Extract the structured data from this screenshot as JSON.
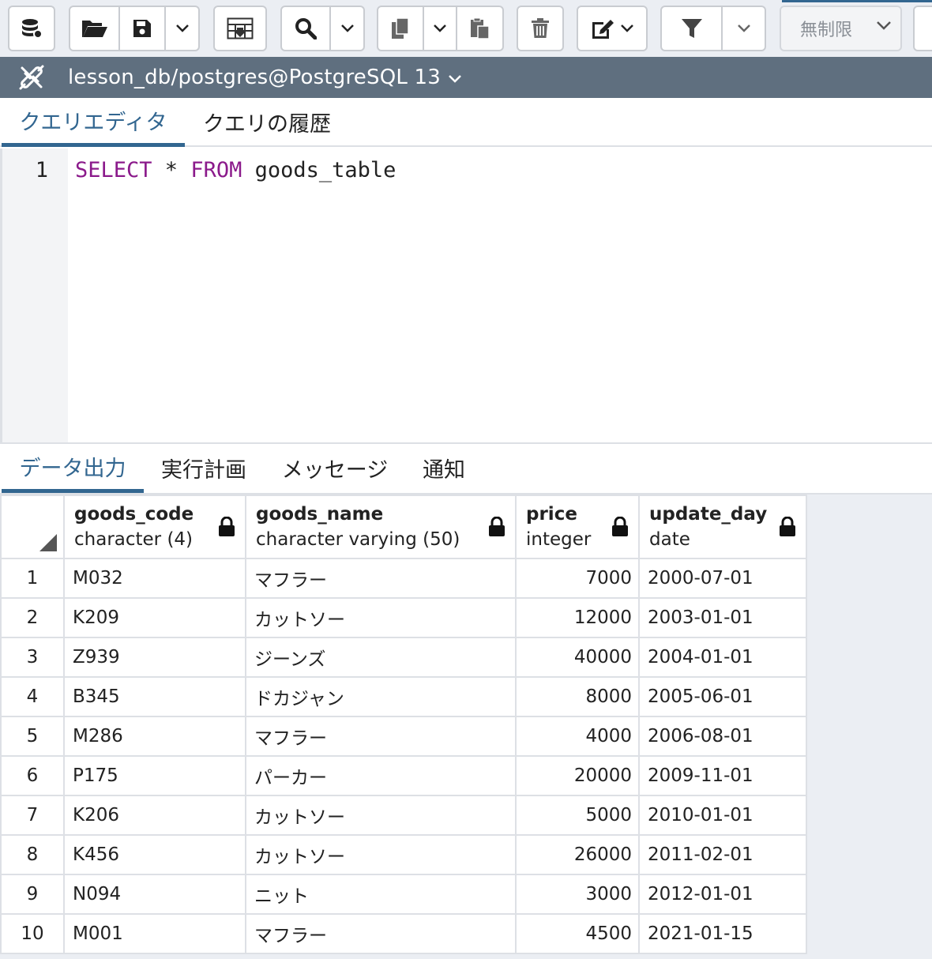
{
  "toolbar": {
    "limit_label": "無制限",
    "icons": [
      "database-icon",
      "folder-open-icon",
      "save-icon",
      "chevron-down-icon",
      "table-download-icon",
      "search-icon",
      "copy-icon",
      "paste-icon",
      "trash-icon",
      "edit-icon",
      "filter-icon"
    ]
  },
  "connection": {
    "label": "lesson_db/postgres@PostgreSQL 13"
  },
  "editor_tabs": [
    {
      "label": "クエリエディタ",
      "active": true
    },
    {
      "label": "クエリの履歴",
      "active": false
    }
  ],
  "editor": {
    "line_number": "1",
    "keyword_select": "SELECT",
    "star": " * ",
    "keyword_from": "FROM",
    "table": " goods_table"
  },
  "output_tabs": [
    {
      "label": "データ出力",
      "active": true
    },
    {
      "label": "実行計画",
      "active": false
    },
    {
      "label": "メッセージ",
      "active": false
    },
    {
      "label": "通知",
      "active": false
    }
  ],
  "grid": {
    "columns": [
      {
        "name": "goods_code",
        "type": "character (4)"
      },
      {
        "name": "goods_name",
        "type": "character varying (50)"
      },
      {
        "name": "price",
        "type": "integer"
      },
      {
        "name": "update_day",
        "type": "date"
      }
    ],
    "rows": [
      {
        "n": "1",
        "code": "M032",
        "name": "マフラー",
        "price": "7000",
        "day": "2000-07-01"
      },
      {
        "n": "2",
        "code": "K209",
        "name": "カットソー",
        "price": "12000",
        "day": "2003-01-01"
      },
      {
        "n": "3",
        "code": "Z939",
        "name": "ジーンズ",
        "price": "40000",
        "day": "2004-01-01"
      },
      {
        "n": "4",
        "code": "B345",
        "name": "ドカジャン",
        "price": "8000",
        "day": "2005-06-01"
      },
      {
        "n": "5",
        "code": "M286",
        "name": "マフラー",
        "price": "4000",
        "day": "2006-08-01"
      },
      {
        "n": "6",
        "code": "P175",
        "name": "パーカー",
        "price": "20000",
        "day": "2009-11-01"
      },
      {
        "n": "7",
        "code": "K206",
        "name": "カットソー",
        "price": "5000",
        "day": "2010-01-01"
      },
      {
        "n": "8",
        "code": "K456",
        "name": "カットソー",
        "price": "26000",
        "day": "2011-02-01"
      },
      {
        "n": "9",
        "code": "N094",
        "name": "ニット",
        "price": "3000",
        "day": "2012-01-01"
      },
      {
        "n": "10",
        "code": "M001",
        "name": "マフラー",
        "price": "4500",
        "day": "2021-01-15"
      }
    ]
  }
}
